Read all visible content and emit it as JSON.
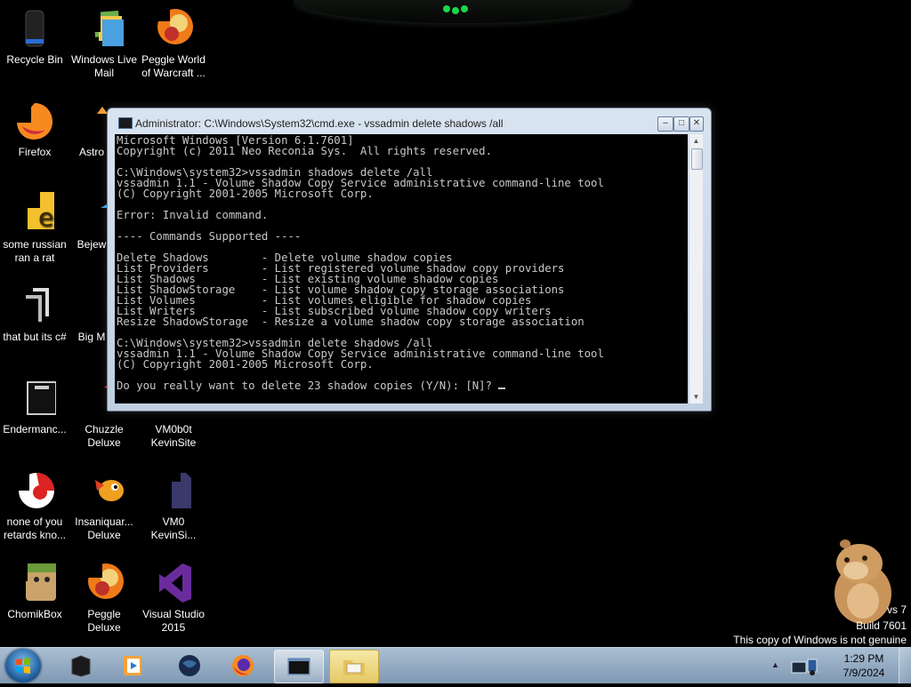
{
  "desktop_icons": [
    {
      "label": "Recycle Bin"
    },
    {
      "label": "Windows Live Mail"
    },
    {
      "label": "Peggle World of Warcraft ..."
    },
    {
      "label": "Firefox"
    },
    {
      "label": "Astro Delu"
    },
    {
      "label": "some russian ran a rat"
    },
    {
      "label": "Bejew Delu"
    },
    {
      "label": "that but its c#"
    },
    {
      "label": "Big M Delu"
    },
    {
      "label": "Endermanc..."
    },
    {
      "label": "Chuzzle Deluxe"
    },
    {
      "label": "VM0b0t KevinSite"
    },
    {
      "label": "none of you retards kno..."
    },
    {
      "label": "Insaniquar... Deluxe"
    },
    {
      "label": "VM0 KevinSi..."
    },
    {
      "label": "ChomikBox"
    },
    {
      "label": "Peggle Deluxe"
    },
    {
      "label": "Visual Studio 2015"
    }
  ],
  "cmd_window": {
    "title": "Administrator: C:\\Windows\\System32\\cmd.exe - vssadmin  delete shadows /all",
    "buttons": {
      "minimize": "–",
      "maximize": "□",
      "close": "✕"
    },
    "lines": [
      "Microsoft Windows [Version 6.1.7601]",
      "Copyright (c) 2011 Neo Reconia Sys.  All rights reserved.",
      "",
      "C:\\Windows\\system32>vssadmin shadows delete /all",
      "vssadmin 1.1 - Volume Shadow Copy Service administrative command-line tool",
      "(C) Copyright 2001-2005 Microsoft Corp.",
      "",
      "Error: Invalid command.",
      "",
      "---- Commands Supported ----",
      "",
      "Delete Shadows        - Delete volume shadow copies",
      "List Providers        - List registered volume shadow copy providers",
      "List Shadows          - List existing volume shadow copies",
      "List ShadowStorage    - List volume shadow copy storage associations",
      "List Volumes          - List volumes eligible for shadow copies",
      "List Writers          - List subscribed volume shadow copy writers",
      "Resize ShadowStorage  - Resize a volume shadow copy storage association",
      "",
      "C:\\Windows\\system32>vssadmin delete shadows /all",
      "vssadmin 1.1 - Volume Shadow Copy Service administrative command-line tool",
      "(C) Copyright 2001-2005 Microsoft Corp.",
      "",
      "Do you really want to delete 23 shadow copies (Y/N): [N]? "
    ]
  },
  "watermark": {
    "line1": "vs 7",
    "line2": "Build 7601",
    "line3": "This copy of Windows is not genuine"
  },
  "taskbar": {
    "items": [
      {
        "name": "terminal-app"
      },
      {
        "name": "media-player"
      },
      {
        "name": "globe-app"
      },
      {
        "name": "firefox"
      },
      {
        "name": "cmd",
        "state": "running"
      },
      {
        "name": "explorer",
        "state": "active"
      }
    ],
    "show_hidden_icon": "▲",
    "clock": {
      "time": "1:29 PM",
      "date": "7/9/2024"
    }
  },
  "colors": {
    "desktop_bg": "#000000",
    "console_text": "#c8c8c8",
    "console_bg": "#000000",
    "taskbar": "#8fa7c0"
  }
}
